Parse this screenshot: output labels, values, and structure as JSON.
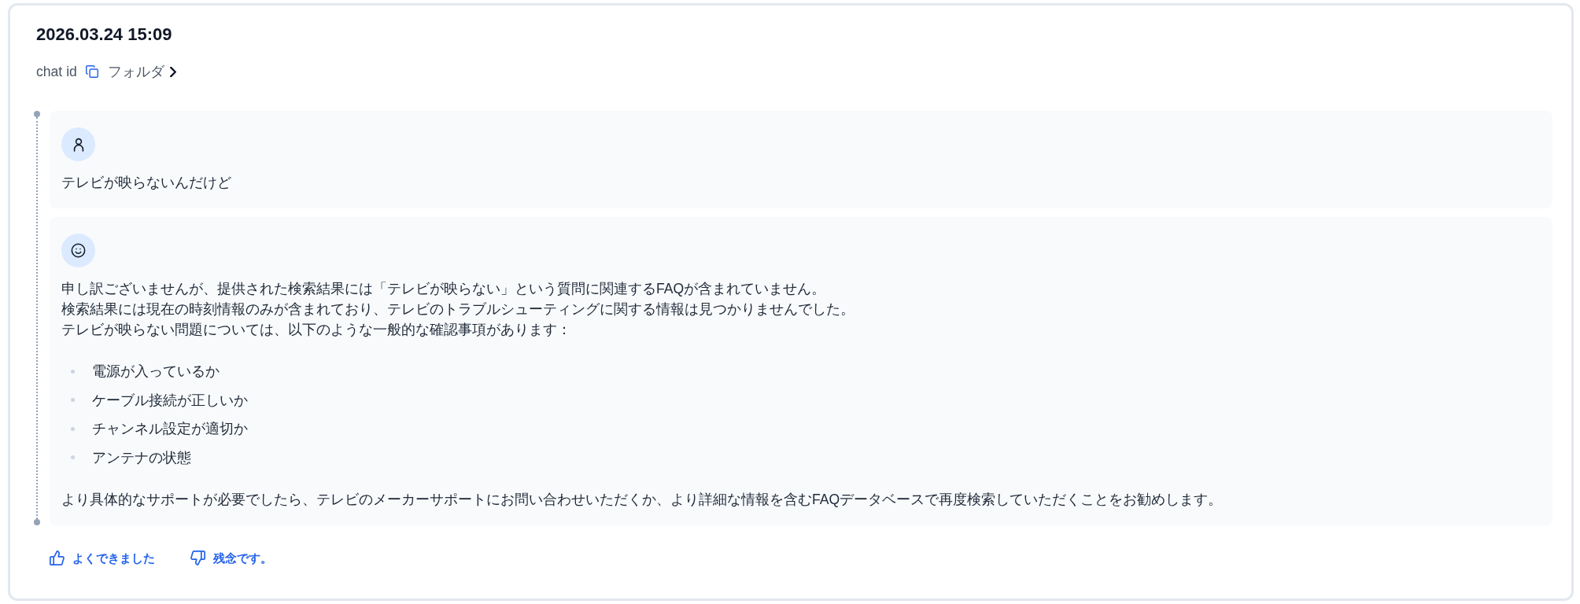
{
  "header": {
    "timestamp": "2026.03.24 15:09",
    "chat_id_label": "chat id",
    "folder_link": "フォルダ"
  },
  "messages": [
    {
      "kind": "user",
      "blocks": [
        {
          "kind": "paragraph",
          "lines": [
            "テレビが映らないんだけど"
          ]
        }
      ]
    },
    {
      "kind": "assistant",
      "blocks": [
        {
          "kind": "paragraph",
          "lines": [
            "申し訳ございませんが、提供された検索結果には「テレビが映らない」という質問に関連するFAQが含まれていません。",
            "検索結果には現在の時刻情報のみが含まれており、テレビのトラブルシューティングに関する情報は見つかりませんでした。",
            "テレビが映らない問題については、以下のような一般的な確認事項があります："
          ]
        },
        {
          "kind": "list",
          "items": [
            "電源が入っているか",
            "ケーブル接続が正しいか",
            "チャンネル設定が適切か",
            "アンテナの状態"
          ]
        },
        {
          "kind": "paragraph",
          "lines": [
            "より具体的なサポートが必要でしたら、テレビのメーカーサポートにお問い合わせいただくか、より詳細な情報を含むFAQデータベースで再度検索していただくことをお勧めします。"
          ]
        }
      ]
    }
  ],
  "feedback": [
    {
      "kind": "like",
      "label": "よくできました"
    },
    {
      "kind": "dislike",
      "label": "残念です。"
    }
  ]
}
